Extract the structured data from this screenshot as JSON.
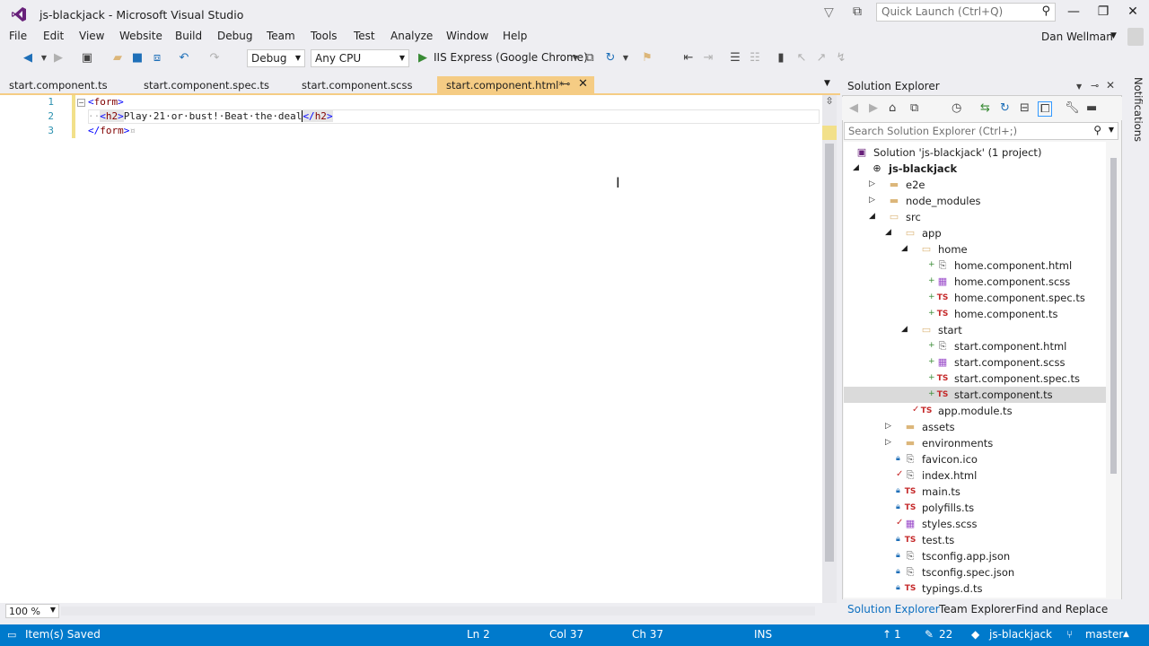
{
  "window": {
    "title": "js-blackjack - Microsoft Visual Studio",
    "quick_launch_placeholder": "Quick Launch (Ctrl+Q)"
  },
  "menu": [
    "File",
    "Edit",
    "View",
    "Website",
    "Build",
    "Debug",
    "Team",
    "Tools",
    "Test",
    "Analyze",
    "Window",
    "Help"
  ],
  "user": {
    "name": "Dan Wellman"
  },
  "toolbar": {
    "config": "Debug",
    "platform": "Any CPU",
    "run_target": "IIS Express (Google Chrome)"
  },
  "tabs": [
    {
      "label": "start.component.ts"
    },
    {
      "label": "start.component.spec.ts"
    },
    {
      "label": "start.component.scss"
    },
    {
      "label": "start.component.html*"
    }
  ],
  "editor": {
    "lines": [
      {
        "no": "1",
        "open": "<",
        "tag": "form",
        "close": ">"
      },
      {
        "no": "2",
        "indent": "··",
        "text": "Play·21·or·bust!·Beat·the·deal"
      },
      {
        "no": "3",
        "open": "</",
        "tag": "form",
        "close": ">",
        "trail": "¤"
      }
    ],
    "zoom": "100 %"
  },
  "solution_explorer": {
    "title": "Solution Explorer",
    "search_placeholder": "Search Solution Explorer (Ctrl+;)",
    "tree": [
      {
        "label": "Solution 'js-blackjack' (1 project)"
      },
      {
        "label": "js-blackjack"
      },
      {
        "label": "e2e"
      },
      {
        "label": "node_modules"
      },
      {
        "label": "src"
      },
      {
        "label": "app"
      },
      {
        "label": "home"
      },
      {
        "label": "home.component.html"
      },
      {
        "label": "home.component.scss"
      },
      {
        "label": "home.component.spec.ts"
      },
      {
        "label": "home.component.ts"
      },
      {
        "label": "start"
      },
      {
        "label": "start.component.html"
      },
      {
        "label": "start.component.scss"
      },
      {
        "label": "start.component.spec.ts"
      },
      {
        "label": "start.component.ts"
      },
      {
        "label": "app.module.ts"
      },
      {
        "label": "assets"
      },
      {
        "label": "environments"
      },
      {
        "label": "favicon.ico"
      },
      {
        "label": "index.html"
      },
      {
        "label": "main.ts"
      },
      {
        "label": "polyfills.ts"
      },
      {
        "label": "styles.scss"
      },
      {
        "label": "test.ts"
      },
      {
        "label": "tsconfig.app.json"
      },
      {
        "label": "tsconfig.spec.json"
      },
      {
        "label": "typings.d.ts"
      }
    ],
    "bottom_tabs": [
      "Solution Explorer",
      "Team Explorer",
      "Find and Replace"
    ],
    "ts_badge": "TS"
  },
  "notifications_label": "Notifications",
  "status": {
    "message": "Item(s) Saved",
    "ln": "Ln 2",
    "col": "Col 37",
    "ch": "Ch 37",
    "mode": "INS",
    "up_count": "1",
    "edit_count": "22",
    "repo": "js-blackjack",
    "branch": "master"
  },
  "colors": {
    "accent": "#007acc",
    "active_tab": "#f5cc84"
  }
}
